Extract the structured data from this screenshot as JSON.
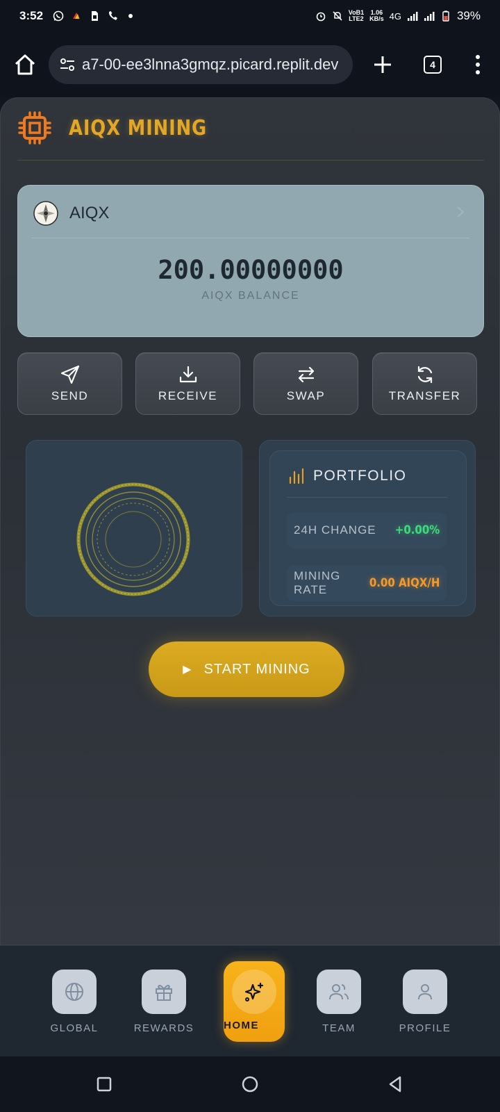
{
  "status_bar": {
    "time": "3:52",
    "net_speed_top": "1.06",
    "net_speed_bottom": "KB/s",
    "volte_top": "VoB1",
    "volte_bottom": "LTE2",
    "network": "4G",
    "battery": "39%"
  },
  "browser": {
    "url": "a7-00-ee3lnna3gmqz.picard.replit.dev",
    "tab_count": "4"
  },
  "app": {
    "title": "AIQX MINING",
    "accent_color": "#e2a726",
    "token": {
      "name": "AIQX",
      "balance": "200.00000000",
      "balance_label": "AIQX BALANCE"
    },
    "actions": [
      {
        "label": "SEND",
        "icon": "send-icon"
      },
      {
        "label": "RECEIVE",
        "icon": "download-icon"
      },
      {
        "label": "SWAP",
        "icon": "swap-icon"
      },
      {
        "label": "TRANSFER",
        "icon": "refresh-icon"
      }
    ],
    "portfolio": {
      "title": "PORTFOLIO",
      "change_label": "24H CHANGE",
      "change_value": "+0.00%",
      "rate_label": "MINING RATE",
      "rate_value": "0.00 AIQX/H"
    },
    "start_button": {
      "label": "START MINING"
    }
  },
  "bottom_nav": {
    "items": [
      {
        "label": "GLOBAL",
        "icon": "globe-icon"
      },
      {
        "label": "REWARDS",
        "icon": "gift-icon"
      },
      {
        "label": "HOME",
        "icon": "sparkles-icon",
        "active": true
      },
      {
        "label": "TEAM",
        "icon": "users-icon"
      },
      {
        "label": "PROFILE",
        "icon": "user-icon"
      }
    ]
  }
}
